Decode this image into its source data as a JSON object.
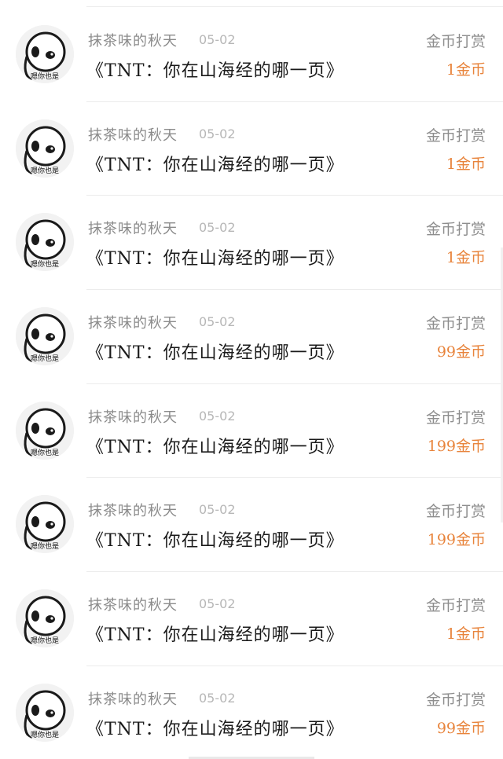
{
  "list": {
    "items": [
      {
        "user": "抹茶味的秋天",
        "date": "05-02",
        "title": "《TNT：你在山海经的哪一页》",
        "reward_label": "金币打赏",
        "amount": "1金币"
      },
      {
        "user": "抹茶味的秋天",
        "date": "05-02",
        "title": "《TNT：你在山海经的哪一页》",
        "reward_label": "金币打赏",
        "amount": "1金币"
      },
      {
        "user": "抹茶味的秋天",
        "date": "05-02",
        "title": "《TNT：你在山海经的哪一页》",
        "reward_label": "金币打赏",
        "amount": "1金币"
      },
      {
        "user": "抹茶味的秋天",
        "date": "05-02",
        "title": "《TNT：你在山海经的哪一页》",
        "reward_label": "金币打赏",
        "amount": "99金币"
      },
      {
        "user": "抹茶味的秋天",
        "date": "05-02",
        "title": "《TNT：你在山海经的哪一页》",
        "reward_label": "金币打赏",
        "amount": "199金币"
      },
      {
        "user": "抹茶味的秋天",
        "date": "05-02",
        "title": "《TNT：你在山海经的哪一页》",
        "reward_label": "金币打赏",
        "amount": "199金币"
      },
      {
        "user": "抹茶味的秋天",
        "date": "05-02",
        "title": "《TNT：你在山海经的哪一页》",
        "reward_label": "金币打赏",
        "amount": "1金币"
      },
      {
        "user": "抹茶味的秋天",
        "date": "05-02",
        "title": "《TNT：你在山海经的哪一页》",
        "reward_label": "金币打赏",
        "amount": "99金币"
      }
    ]
  },
  "avatar": {
    "caption": "嗯你也是",
    "icon": "meme-face-avatar"
  },
  "colors": {
    "amount": "#e8843c",
    "username": "#8b8b8b",
    "date": "#b7b7b7",
    "title": "#1a1a1a",
    "divider": "#ececec"
  }
}
